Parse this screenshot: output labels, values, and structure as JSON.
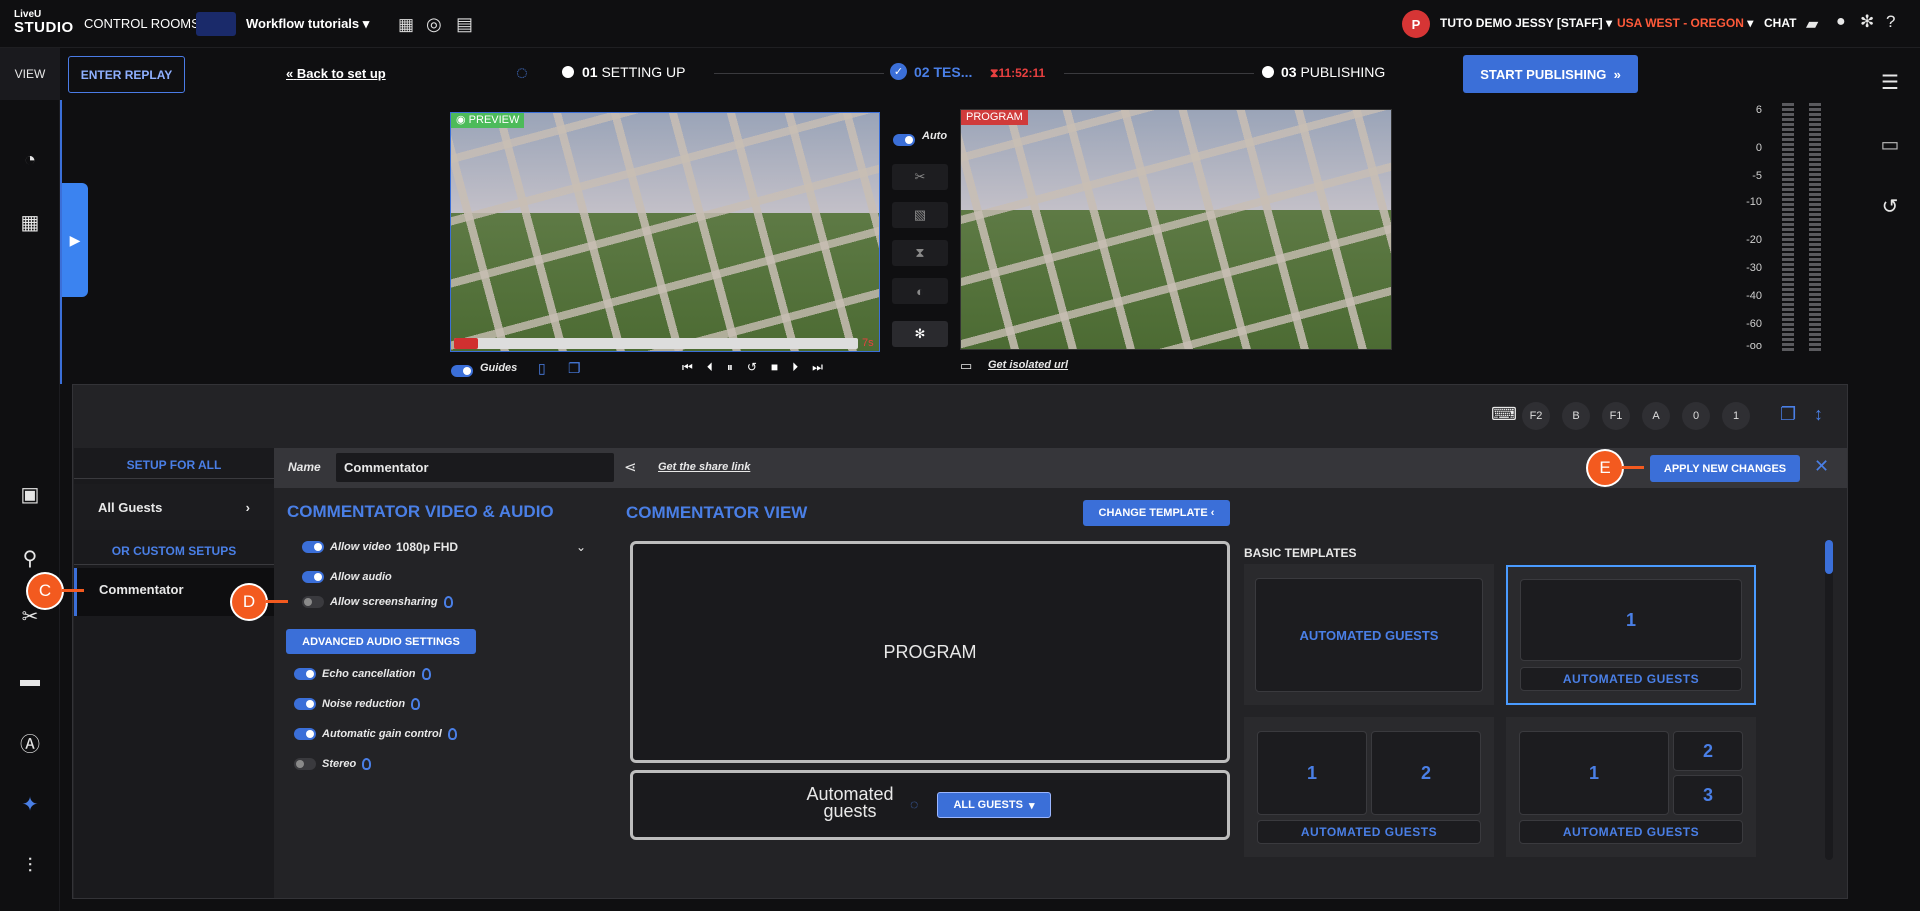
{
  "topbar": {
    "logo_line1": "LiveU",
    "logo_line2": "STUDIO",
    "control_rooms": "CONTROL ROOMS",
    "workflow": "Workflow tutorials",
    "user_initial": "P",
    "user_name": "TUTO DEMO JESSY [STAFF]",
    "region": "USA WEST - OREGON",
    "chat": "CHAT"
  },
  "leftrail": {
    "view_label": "VIEW"
  },
  "steps": {
    "back_link": "Back to set up",
    "step1_num": "01",
    "step1_label": "SETTING UP",
    "step2_num": "02",
    "step2_label": "TES...",
    "timer": "11:52:11",
    "step3_num": "03",
    "step3_label": "PUBLISHING"
  },
  "buttons": {
    "enter_replay": "ENTER REPLAY",
    "start_publishing": "START PUBLISHING"
  },
  "preview": {
    "label": "PREVIEW",
    "time": "7s",
    "guides": "Guides",
    "progress": 0.06
  },
  "transition": {
    "auto": "Auto"
  },
  "program": {
    "label": "PROGRAM",
    "isolated": "Get isolated url"
  },
  "meter_scale": [
    "6",
    "0",
    "-5",
    "-10",
    "-20",
    "-30",
    "-40",
    "-60",
    "-oo"
  ],
  "keys": [
    "F2",
    "B",
    "F1",
    "A",
    "0",
    "1"
  ],
  "setup": {
    "setup_for_all": "SETUP FOR ALL",
    "all_guests": "All Guests",
    "custom_setups": "OR CUSTOM SETUPS",
    "commentator": "Commentator"
  },
  "namebar": {
    "name_label": "Name",
    "name_value": "Commentator",
    "share_link": "Get the share link",
    "apply": "APPLY NEW CHANGES"
  },
  "av": {
    "title": "COMMENTATOR VIDEO & AUDIO",
    "allow_video": "Allow video",
    "resolution": "1080p FHD",
    "allow_audio": "Allow audio",
    "allow_screensharing": "Allow screensharing",
    "advanced_audio": "ADVANCED AUDIO SETTINGS",
    "echo": "Echo cancellation",
    "noise": "Noise reduction",
    "agc": "Automatic gain control",
    "stereo": "Stereo"
  },
  "view": {
    "title": "COMMENTATOR VIEW",
    "change_template": "CHANGE TEMPLATE",
    "program_box": "PROGRAM",
    "automated_guests": "Automated guests",
    "all_guests_btn": "ALL GUESTS"
  },
  "templates": {
    "heading": "BASIC TEMPLATES",
    "automated": "AUTOMATED GUESTS",
    "n1": "1",
    "n2": "2",
    "n3": "3"
  },
  "callouts": {
    "c": "C",
    "d": "D",
    "e": "E"
  }
}
